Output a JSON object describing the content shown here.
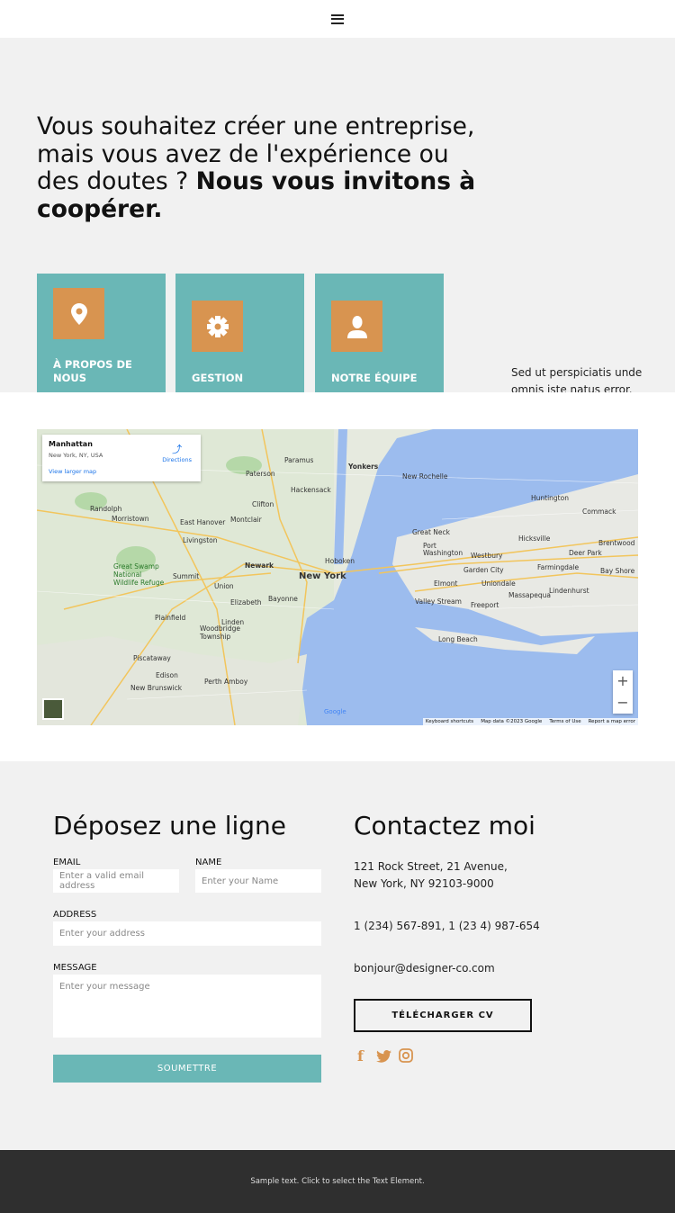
{
  "header": {
    "menu_icon": "hamburger-icon"
  },
  "hero": {
    "title_regular": "Vous souhaitez créer une entreprise, mais vous avez de l'expérience ou des doutes ? ",
    "title_bold": "Nous vous invitons à coopérer.",
    "cards": [
      {
        "label": "À PROPOS DE NOUS",
        "icon": "map-pin-icon"
      },
      {
        "label": "GESTION",
        "icon": "gear-icon"
      },
      {
        "label": "NOTRE ÉQUIPE",
        "icon": "user-icon"
      }
    ],
    "side_text": "Sed ut perspiciatis unde omnis iste natus error.",
    "colors": {
      "card": "#6ab7b6",
      "icon_bg": "#d89450"
    }
  },
  "map": {
    "place": "Manhattan",
    "address": "New York, NY, USA",
    "directions": "Directions",
    "larger": "View larger map",
    "labels": [
      "New York",
      "Newark",
      "Yonkers",
      "Paterson",
      "Hackensack",
      "Clifton",
      "Montclair",
      "Livingston",
      "Elizabeth",
      "Union",
      "Summit",
      "Plainfield",
      "Edison",
      "Perth Amboy",
      "Hoboken",
      "Great Neck",
      "Garden City",
      "Freeport",
      "Long Beach",
      "Huntington",
      "Hicksville",
      "Valley Stream",
      "Westbury",
      "New Rochelle",
      "Paramus",
      "Morristown",
      "Woodbridge Township",
      "New Brunswick",
      "Lindenhurst",
      "Massapequa",
      "Commack",
      "Brentwood",
      "Bay Shore",
      "Deer Park",
      "Elmont",
      "Uniondale",
      "Farmingdale",
      "Port Washington",
      "Piscataway",
      "Linden",
      "Bayonne",
      "Randolph",
      "East Hanover",
      "Great Swamp National Wildlife Refuge",
      "Google"
    ],
    "zoom_in": "+",
    "zoom_out": "−",
    "attribution": [
      "Keyboard shortcuts",
      "Map data ©2023 Google",
      "Terms of Use",
      "Report a map error"
    ]
  },
  "form": {
    "title": "Déposez une ligne",
    "email_label": "EMAIL",
    "email_placeholder": "Enter a valid email address",
    "name_label": "NAME",
    "name_placeholder": "Enter your Name",
    "address_label": "ADDRESS",
    "address_placeholder": "Enter your address",
    "message_label": "MESSAGE",
    "message_placeholder": "Enter your message",
    "submit": "SOUMETTRE"
  },
  "contact": {
    "title": "Contactez moi",
    "address": "121 Rock Street, 21 Avenue, New York, NY 92103-9000",
    "phone": "1 (234) 567-891, 1 (23 4) 987-654",
    "email": "bonjour@designer-co.com",
    "cv_button": "TÉLÉCHARGER CV",
    "social": [
      "facebook-icon",
      "twitter-icon",
      "instagram-icon"
    ]
  },
  "footer": {
    "text": "Sample text. Click to select the Text Element."
  }
}
